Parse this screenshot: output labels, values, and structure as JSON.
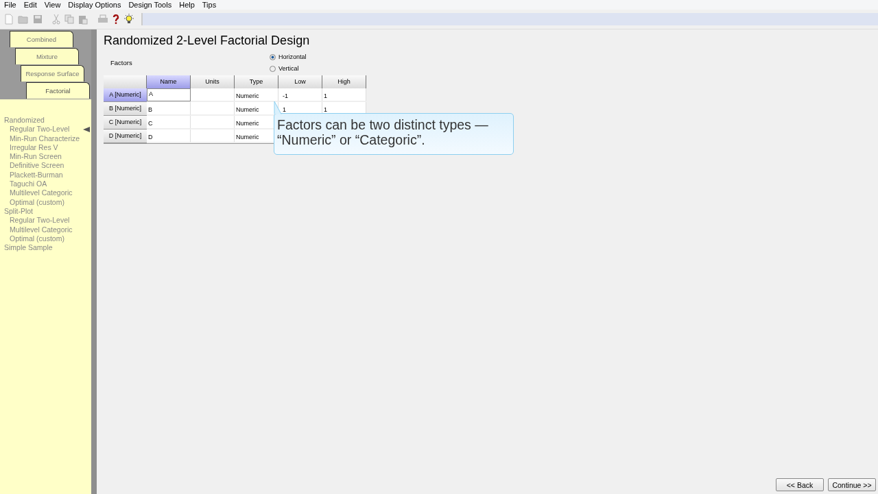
{
  "menu": [
    "File",
    "Edit",
    "View",
    "Display Options",
    "Design Tools",
    "Help",
    "Tips"
  ],
  "toolbar": [
    {
      "kind": "new",
      "disabled": true
    },
    {
      "kind": "open",
      "disabled": true
    },
    {
      "kind": "save",
      "disabled": true
    },
    {
      "kind": "cut",
      "disabled": true
    },
    {
      "kind": "copy",
      "disabled": true
    },
    {
      "kind": "paste",
      "disabled": true
    },
    {
      "kind": "print",
      "disabled": true
    },
    {
      "kind": "help",
      "disabled": false
    },
    {
      "kind": "tip",
      "disabled": false
    }
  ],
  "side_tabs": [
    {
      "label": "Combined",
      "selected": false
    },
    {
      "label": "Mixture",
      "selected": false
    },
    {
      "label": "Response Surface",
      "selected": false
    },
    {
      "label": "Factorial",
      "selected": true
    }
  ],
  "design_list": [
    {
      "label": "Randomized",
      "selected": false,
      "children": [
        {
          "label": "Regular Two-Level",
          "selected": true
        },
        {
          "label": "Min-Run Characterize",
          "selected": false
        },
        {
          "label": "Irregular Res V",
          "selected": false
        },
        {
          "label": "Min-Run Screen",
          "selected": false
        },
        {
          "label": "Definitive Screen",
          "selected": false
        },
        {
          "label": "Plackett-Burman",
          "selected": false
        },
        {
          "label": "Taguchi OA",
          "selected": false
        },
        {
          "label": "Multilevel Categoric",
          "selected": false
        },
        {
          "label": "Optimal (custom)",
          "selected": false
        }
      ]
    },
    {
      "label": "Split-Plot",
      "selected": false,
      "children": [
        {
          "label": "Regular Two-Level",
          "selected": false
        },
        {
          "label": "Multilevel Categoric",
          "selected": false
        },
        {
          "label": "Optimal (custom)",
          "selected": false
        }
      ]
    },
    {
      "label": "Simple Sample",
      "selected": false
    }
  ],
  "title": "Randomized 2-Level Factorial Design",
  "factors_label": "Factors",
  "orientation": [
    {
      "label": "Horizontal",
      "selected": true
    },
    {
      "label": "Vertical",
      "selected": false
    }
  ],
  "table": {
    "columns": [
      {
        "label": "Name",
        "selected": true
      },
      {
        "label": "Units",
        "selected": false
      },
      {
        "label": "Type",
        "selected": false
      },
      {
        "label": "Low",
        "selected": false
      },
      {
        "label": "High",
        "selected": false
      }
    ],
    "rows": [
      {
        "header": "A [Numeric]",
        "selected": true,
        "cells": [
          "A",
          "",
          "Numeric",
          "-1",
          "1"
        ]
      },
      {
        "header": "B [Numeric]",
        "selected": false,
        "cells": [
          "B",
          "",
          "Numeric",
          "1",
          "1"
        ]
      },
      {
        "header": "C [Numeric]",
        "selected": false,
        "cells": [
          "C",
          "",
          "Numeric",
          "",
          ""
        ]
      },
      {
        "header": "D [Numeric]",
        "selected": false,
        "cells": [
          "D",
          "",
          "Numeric",
          "",
          ""
        ]
      }
    ]
  },
  "tooltip": "Factors can be two distinct types — “Numeric” or “Categoric”.",
  "buttons": [
    "<< Back",
    "Continue >>"
  ]
}
